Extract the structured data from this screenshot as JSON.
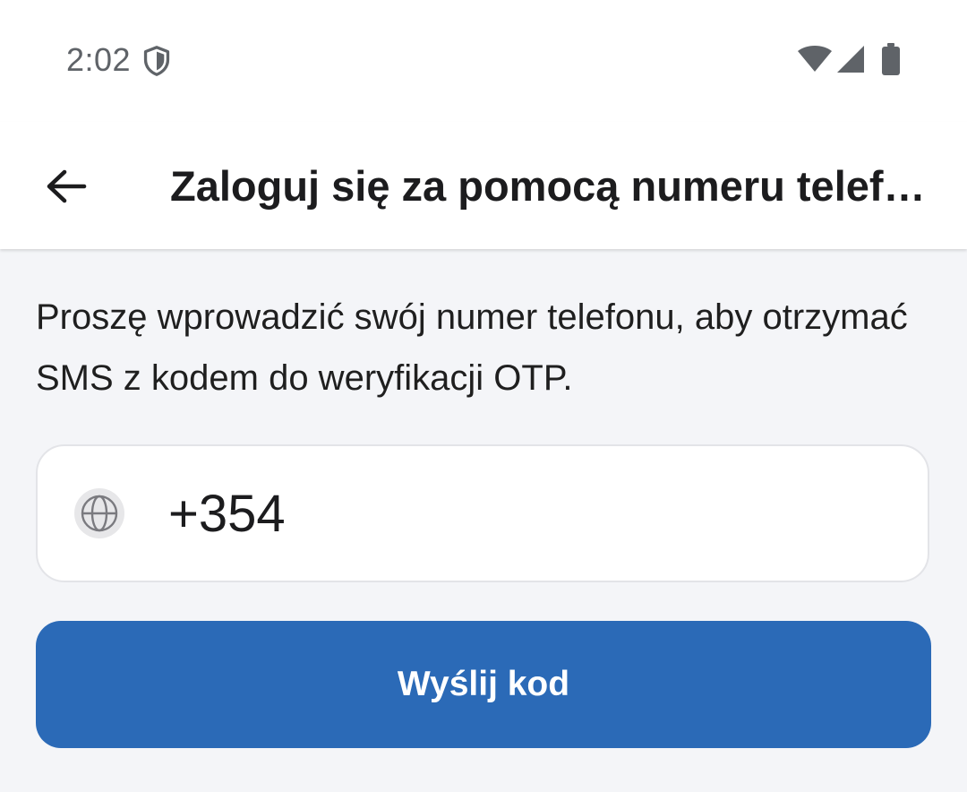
{
  "status_bar": {
    "time": "2:02",
    "icons": [
      "shield-icon",
      "wifi-icon",
      "signal-icon",
      "battery-icon"
    ]
  },
  "app_bar": {
    "title": "Zaloguj się za pomocą numeru telefonu",
    "back_icon": "arrow-left-icon"
  },
  "main": {
    "description": "Proszę wprowadzić swój numer telefonu, aby otrzymać SMS z kodem do weryfikacji OTP.",
    "phone_field": {
      "country_icon": "globe-icon",
      "value": "+354"
    },
    "send_button_label": "Wyślij kod"
  },
  "colors": {
    "accent": "#2B6AB7",
    "background": "#F4F5F8",
    "surface": "#FFFFFF",
    "text": "#1C1C1E",
    "status_text": "#5F6368"
  }
}
